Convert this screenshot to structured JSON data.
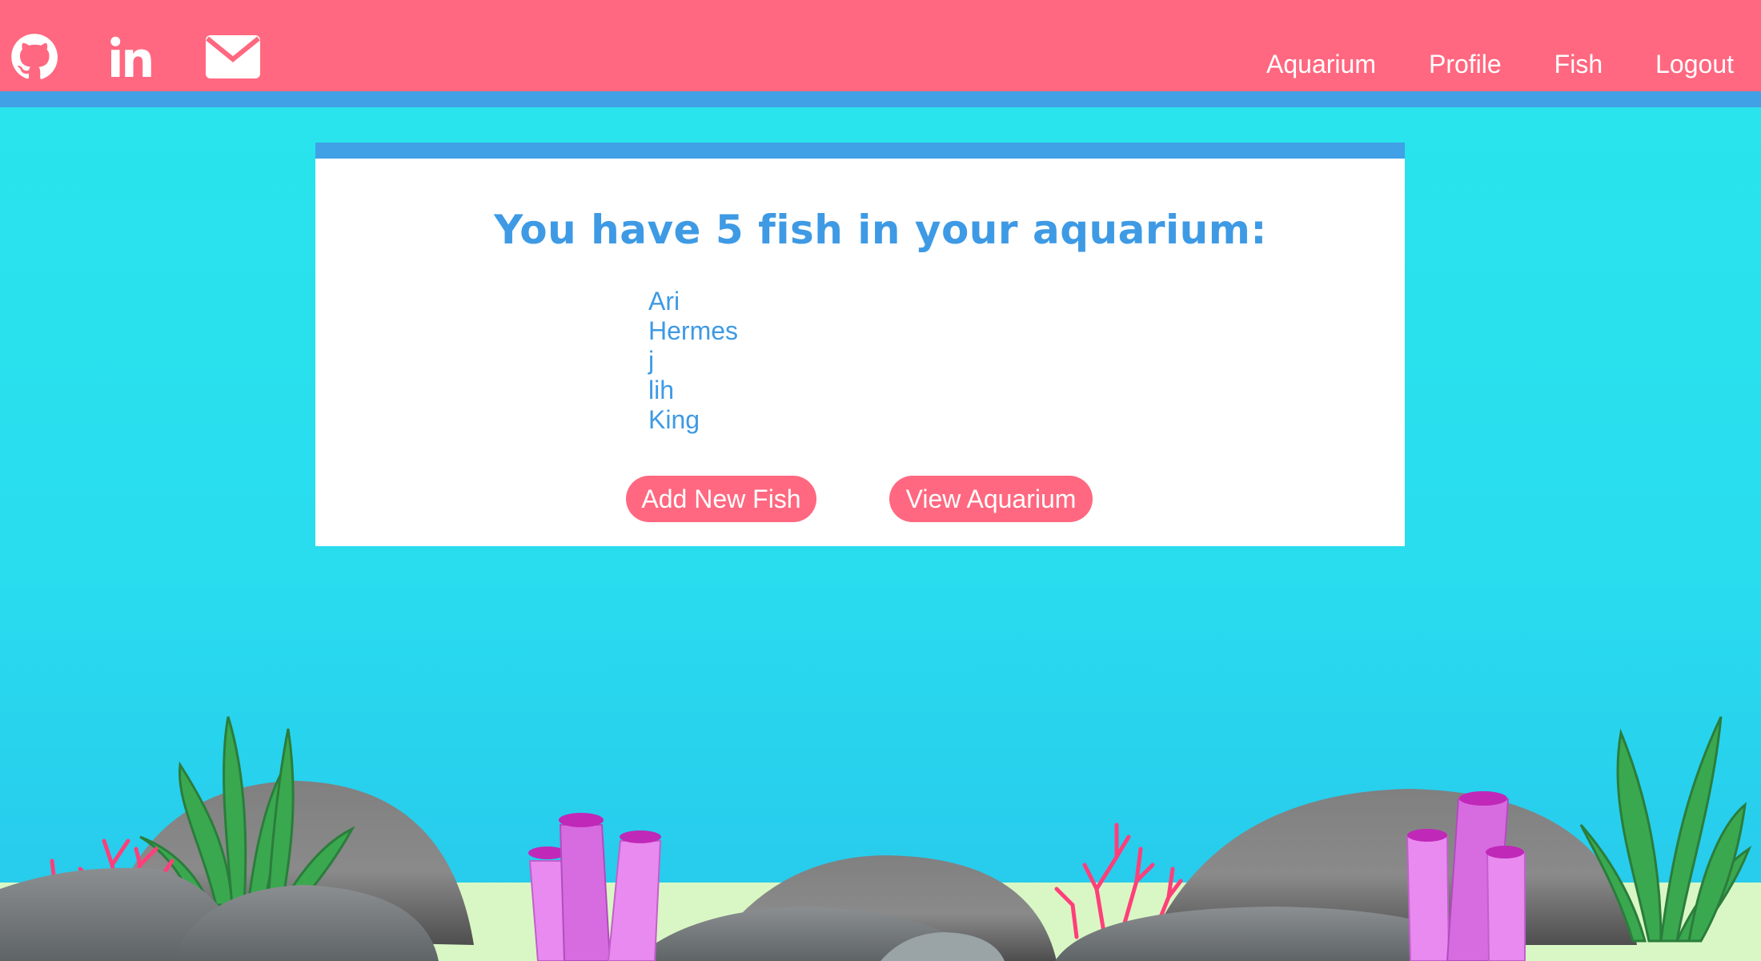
{
  "nav": {
    "social": [
      "github-icon",
      "linkedin-icon",
      "mail-icon"
    ],
    "links": [
      "Aquarium",
      "Profile",
      "Fish",
      "Logout"
    ]
  },
  "card": {
    "title": "You have 5 fish in your aquarium:",
    "fish": [
      "Ari",
      "Hermes",
      "j",
      "lih",
      "King"
    ],
    "buttons": {
      "add": "Add New Fish",
      "view": "View Aquarium"
    }
  },
  "colors": {
    "nav_bg": "#ff6880",
    "accent_blue": "#41a1e6",
    "water": "#29e6ec",
    "sand": "#d9f7c4",
    "button": "#ff6880"
  }
}
